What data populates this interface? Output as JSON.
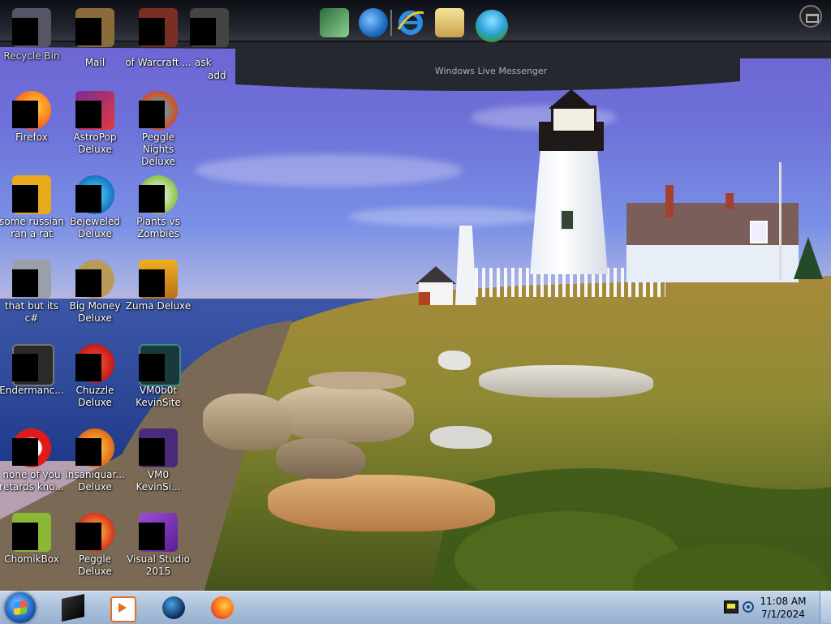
{
  "dock": {
    "apps": [
      {
        "name": "Spreadsheet Grid"
      },
      {
        "name": "Windows Live Download"
      },
      {
        "name": "Internet Explorer"
      },
      {
        "name": "Photo Gallery"
      },
      {
        "name": "Windows Live Messenger"
      }
    ],
    "tooltip": "Windows Live Messenger",
    "accent": "#1a1c24"
  },
  "desktop": {
    "icons": [
      {
        "label": "Recycle Bin",
        "icon": "recycle-bin-icon"
      },
      {
        "label": "Mail",
        "icon": "mail-icon"
      },
      {
        "label": "of Warcraft ...",
        "icon": "warcraft-icon"
      },
      {
        "label": "ask",
        "icon": "ask-icon"
      },
      {
        "label": "add",
        "icon": "add-icon"
      },
      {
        "label": "Firefox",
        "icon": "firefox-icon"
      },
      {
        "label": "AstroPop Deluxe",
        "icon": "astropop-icon"
      },
      {
        "label": "Peggle Nights Deluxe",
        "icon": "peggle-nights-icon"
      },
      {
        "label": "some russian ran a rat",
        "icon": "rat-icon"
      },
      {
        "label": "Bejeweled Deluxe",
        "icon": "bejeweled-icon"
      },
      {
        "label": "Plants vs Zombies",
        "icon": "plants-vs-zombies-icon"
      },
      {
        "label": "that but its c#",
        "icon": "stack-icon"
      },
      {
        "label": "Big Money Deluxe",
        "icon": "big-money-icon"
      },
      {
        "label": "Zuma Deluxe",
        "icon": "zuma-icon"
      },
      {
        "label": "Endermanc...",
        "icon": "terminal-icon"
      },
      {
        "label": "Chuzzle Deluxe",
        "icon": "chuzzle-icon"
      },
      {
        "label": "VM0b0t KevinSite",
        "icon": "vm-terminal-icon"
      },
      {
        "label": "none of you retards kno...",
        "icon": "opera-icon"
      },
      {
        "label": "Insaniquar... Deluxe",
        "icon": "insaniquarium-icon"
      },
      {
        "label": "VM0 KevinSi...",
        "icon": "vm0-icon"
      },
      {
        "label": "ChomikBox",
        "icon": "chomikbox-icon"
      },
      {
        "label": "Peggle Deluxe",
        "icon": "peggle-icon"
      },
      {
        "label": "Visual Studio 2015",
        "icon": "visual-studio-icon"
      }
    ]
  },
  "taskbar": {
    "pinned": [
      {
        "name": "Black Box",
        "icon": "blackbox-icon"
      },
      {
        "name": "Media Player",
        "icon": "media-player-icon"
      },
      {
        "name": "Globe",
        "icon": "globe-icon"
      },
      {
        "name": "Firefox",
        "icon": "firefox-icon"
      }
    ],
    "clock": {
      "time": "11:08 AM",
      "date": "7/1/2024"
    }
  }
}
